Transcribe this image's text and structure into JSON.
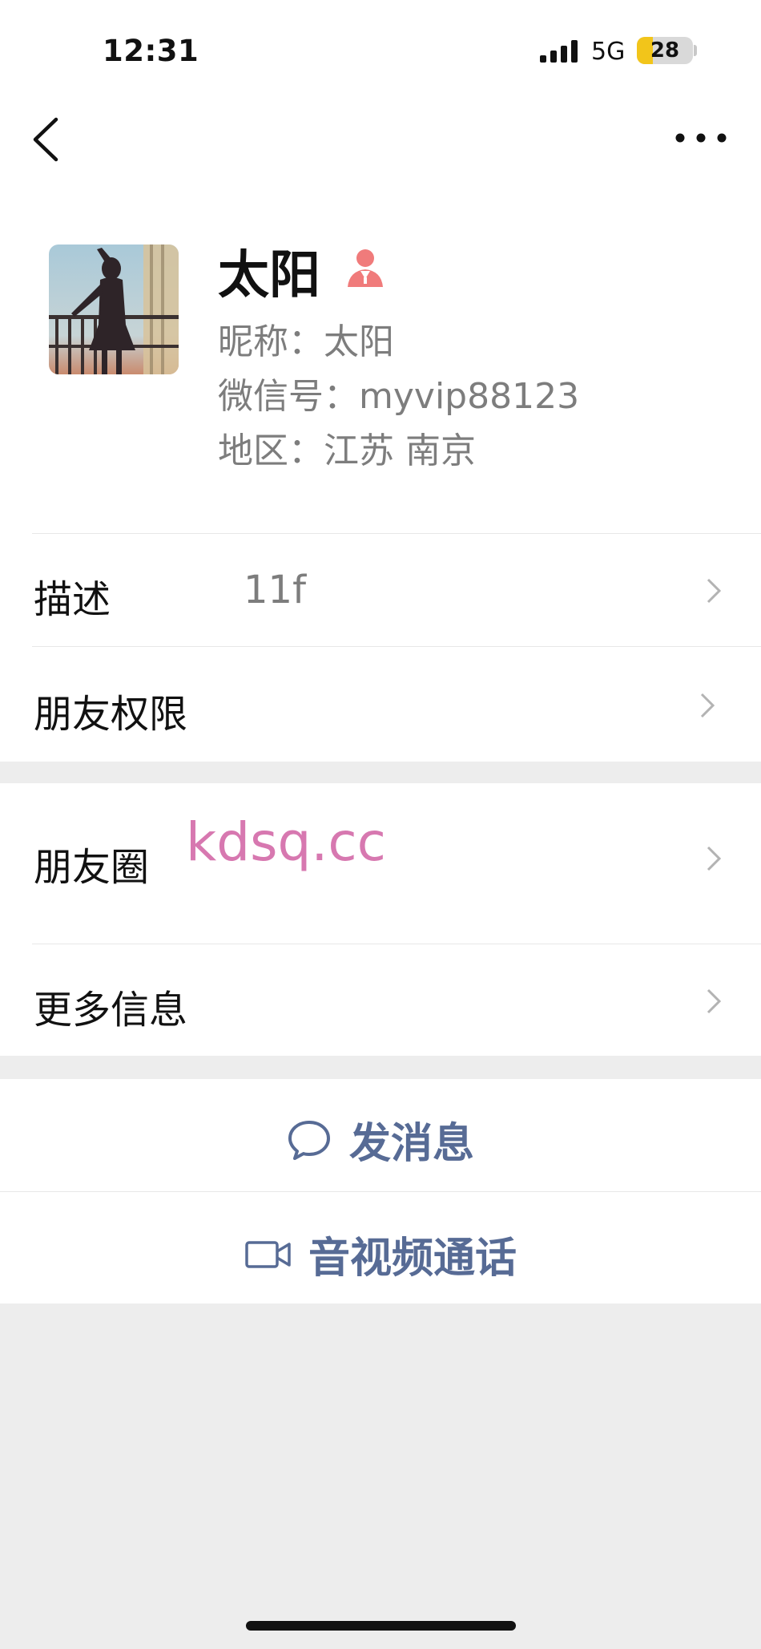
{
  "status_bar": {
    "time": "12:31",
    "network": "5G",
    "battery": "28",
    "battery_level": 0.28
  },
  "header": {
    "back_icon": "chevron-left-icon",
    "more_icon": "ellipsis-icon"
  },
  "profile": {
    "name": "太阳",
    "gender_icon": "female-icon",
    "nickname": "昵称：太阳",
    "wechat_id": "微信号：myvip88123",
    "region": "地区：江苏 南京"
  },
  "rows": {
    "description": {
      "label": "描述",
      "value": "11f"
    },
    "permissions": {
      "label": "朋友权限"
    },
    "moments": {
      "label": "朋友圈"
    },
    "more_info": {
      "label": "更多信息"
    }
  },
  "watermark": "kdsq.cc",
  "actions": {
    "message": "发消息",
    "video_call": "音视频通话"
  },
  "colors": {
    "link": "#576b95",
    "watermark": "#d778b0",
    "gender": "#f07b7b",
    "background": "#ededed"
  }
}
